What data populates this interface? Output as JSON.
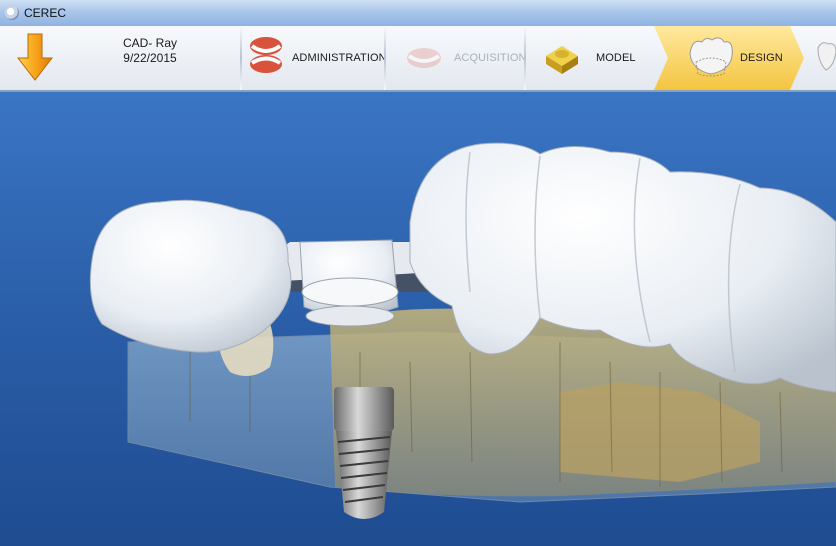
{
  "window": {
    "title": "CEREC"
  },
  "case": {
    "name": "CAD- Ray",
    "date": "9/22/2015"
  },
  "steps": [
    {
      "label": "ADMINISTRATION",
      "state": "done"
    },
    {
      "label": "ACQUISITION",
      "state": "disabled"
    },
    {
      "label": "MODEL",
      "state": "done"
    },
    {
      "label": "DESIGN",
      "state": "active"
    }
  ],
  "colors": {
    "active_step": "#f3c540",
    "viewport_background": "#2a5ea8",
    "restoration": "#e9eef4",
    "gingiva_model": "#b9a56a"
  },
  "icons": {
    "back": "arrow-down-icon",
    "administration": "denture-icon",
    "acquisition": "scan-icon",
    "model": "model-block-icon",
    "design": "crown-icon"
  }
}
